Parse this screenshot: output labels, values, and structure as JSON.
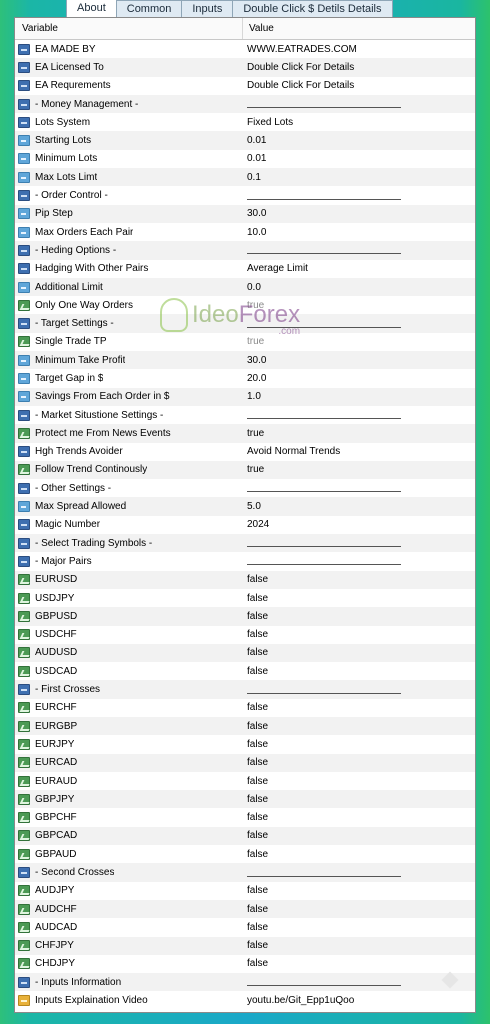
{
  "tabs": [
    {
      "label": "About",
      "active": true
    },
    {
      "label": "Common",
      "active": false
    },
    {
      "label": "Inputs",
      "active": false
    },
    {
      "label": "Double Click $ Detils Details",
      "active": false
    }
  ],
  "table": {
    "columns": {
      "variable": "Variable",
      "value": "Value"
    },
    "rows": [
      {
        "icon": "i123",
        "name": "EA MADE BY",
        "value": "WWW.EATRADES.COM"
      },
      {
        "icon": "i123",
        "name": "EA Licensed To",
        "value": "Double Click For Details"
      },
      {
        "icon": "i123",
        "name": "EA Requrements",
        "value": "Double Click For Details"
      },
      {
        "icon": "i123",
        "name": "- Money Management -",
        "value": "",
        "separator": true
      },
      {
        "icon": "i123",
        "name": "Lots System",
        "value": "Fixed Lots"
      },
      {
        "icon": "i12",
        "name": "Starting Lots",
        "value": "0.01"
      },
      {
        "icon": "i12",
        "name": "Minimum Lots",
        "value": "0.01"
      },
      {
        "icon": "i12",
        "name": "Max Lots Limt",
        "value": "0.1"
      },
      {
        "icon": "i123",
        "name": "- Order Control -",
        "value": "",
        "separator": true
      },
      {
        "icon": "i12",
        "name": "Pip Step",
        "value": "30.0"
      },
      {
        "icon": "i12",
        "name": "Max Orders Each Pair",
        "value": "10.0"
      },
      {
        "icon": "i123",
        "name": "- Heding Options -",
        "value": "",
        "separator": true
      },
      {
        "icon": "i123",
        "name": "Hadging With Other Pairs",
        "value": "Average Limit"
      },
      {
        "icon": "i12",
        "name": "Additional Limit",
        "value": "0.0"
      },
      {
        "icon": "itrend",
        "name": "Only One Way Orders",
        "value": "true",
        "muted": true
      },
      {
        "icon": "i123",
        "name": "- Target Settings -",
        "value": "",
        "separator": true
      },
      {
        "icon": "itrend",
        "name": "Single Trade TP",
        "value": "true",
        "muted": true
      },
      {
        "icon": "i12",
        "name": "Minimum Take Profit",
        "value": "30.0"
      },
      {
        "icon": "i12",
        "name": "Target Gap in $",
        "value": "20.0"
      },
      {
        "icon": "i12",
        "name": "Savings From Each Order in $",
        "value": "1.0"
      },
      {
        "icon": "i123",
        "name": "- Market Situstione Settings -",
        "value": "",
        "separator": true
      },
      {
        "icon": "itrend",
        "name": "Protect me From News Events",
        "value": "true"
      },
      {
        "icon": "i123",
        "name": "Hgh Trends Avoider",
        "value": "Avoid Normal Trends"
      },
      {
        "icon": "itrend",
        "name": "Follow Trend Continously",
        "value": "true"
      },
      {
        "icon": "i123",
        "name": "- Other Settings -",
        "value": "",
        "separator": true
      },
      {
        "icon": "i12",
        "name": "Max Spread Allowed",
        "value": "5.0"
      },
      {
        "icon": "i123",
        "name": "Magic Number",
        "value": "2024"
      },
      {
        "icon": "i123",
        "name": "- Select Trading Symbols -",
        "value": "",
        "separator": true
      },
      {
        "icon": "i123",
        "name": "- Major Pairs",
        "value": "",
        "separator": true
      },
      {
        "icon": "itrend",
        "name": "EURUSD",
        "value": "false"
      },
      {
        "icon": "itrend",
        "name": "USDJPY",
        "value": "false"
      },
      {
        "icon": "itrend",
        "name": "GBPUSD",
        "value": "false"
      },
      {
        "icon": "itrend",
        "name": "USDCHF",
        "value": "false"
      },
      {
        "icon": "itrend",
        "name": "AUDUSD",
        "value": "false"
      },
      {
        "icon": "itrend",
        "name": "USDCAD",
        "value": "false"
      },
      {
        "icon": "i123",
        "name": "- First Crosses",
        "value": "",
        "separator": true
      },
      {
        "icon": "itrend",
        "name": "EURCHF",
        "value": "false"
      },
      {
        "icon": "itrend",
        "name": "EURGBP",
        "value": "false"
      },
      {
        "icon": "itrend",
        "name": "EURJPY",
        "value": "false"
      },
      {
        "icon": "itrend",
        "name": "EURCAD",
        "value": "false"
      },
      {
        "icon": "itrend",
        "name": "EURAUD",
        "value": "false"
      },
      {
        "icon": "itrend",
        "name": "GBPJPY",
        "value": "false"
      },
      {
        "icon": "itrend",
        "name": "GBPCHF",
        "value": "false"
      },
      {
        "icon": "itrend",
        "name": "GBPCAD",
        "value": "false"
      },
      {
        "icon": "itrend",
        "name": "GBPAUD",
        "value": "false"
      },
      {
        "icon": "i123",
        "name": "- Second Crosses",
        "value": "",
        "separator": true
      },
      {
        "icon": "itrend",
        "name": "AUDJPY",
        "value": "false"
      },
      {
        "icon": "itrend",
        "name": "AUDCHF",
        "value": "false"
      },
      {
        "icon": "itrend",
        "name": "AUDCAD",
        "value": "false"
      },
      {
        "icon": "itrend",
        "name": "CHFJPY",
        "value": "false"
      },
      {
        "icon": "itrend",
        "name": "CHDJPY",
        "value": "false"
      },
      {
        "icon": "i123",
        "name": "- Inputs Information",
        "value": "",
        "separator": true
      },
      {
        "icon": "iab",
        "name": "Inputs Explaination Video",
        "value": "youtu.be/Git_Epp1uQoo"
      }
    ]
  },
  "watermark": {
    "part1": "Ideo",
    "part2": "Forex",
    "suffix": ".com"
  },
  "colors": {
    "accent": "#1aa8c9",
    "tab_bg": "#dfeaf3",
    "row_alt": "#f2f2f2"
  }
}
